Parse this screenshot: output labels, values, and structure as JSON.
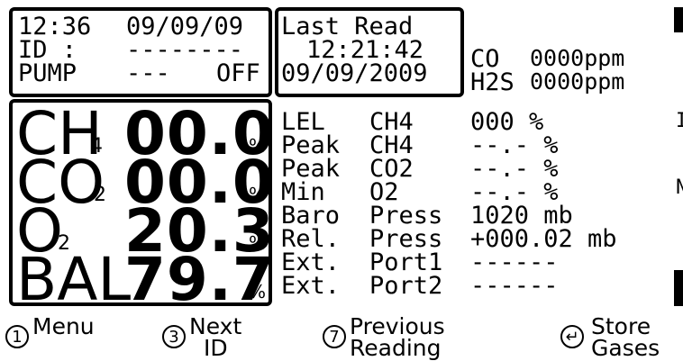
{
  "header_left": {
    "time": "12:36",
    "date": "09/09/09",
    "id_label": "ID :",
    "id_value": "--------",
    "pump_label": "PUMP",
    "pump_dashes": "---",
    "pump_state": "OFF"
  },
  "header_mid": {
    "title": "Last Read",
    "time": "12:21:42",
    "date": "09/09/2009"
  },
  "header_right": {
    "co_label": "CO",
    "co_value": "0000ppm",
    "h2s_label": "H2S",
    "h2s_value": "0000ppm"
  },
  "gases": [
    {
      "name": "CH",
      "sub": "4",
      "value": "00.0",
      "unit": "%"
    },
    {
      "name": "CO",
      "sub": "2",
      "value": "00.0",
      "unit": "%"
    },
    {
      "name": "O",
      "sub": "2",
      "value": "20.3",
      "unit": "%"
    },
    {
      "name": "BAL",
      "sub": "",
      "value": "79.7",
      "unit": "%"
    }
  ],
  "details": [
    {
      "a": "LEL",
      "b": "CH4",
      "v": "000 %"
    },
    {
      "a": "Peak",
      "b": "CH4",
      "v": "--.- %"
    },
    {
      "a": "Peak",
      "b": "CO2",
      "v": "--.- %"
    },
    {
      "a": "Min",
      "b": "O2",
      "v": "--.- %"
    },
    {
      "a": "Baro",
      "b": "Press",
      "v": "1020 mb"
    },
    {
      "a": "Rel.",
      "b": "Press",
      "v": "+000.02 mb"
    },
    {
      "a": "Ext.",
      "b": "Port1",
      "v": "------"
    },
    {
      "a": "Ext.",
      "b": "Port2",
      "v": "------"
    }
  ],
  "nav": [
    {
      "key": "1",
      "line1": "Menu",
      "line2": ""
    },
    {
      "key": "3",
      "line1": "Next",
      "line2": "ID"
    },
    {
      "key": "7",
      "line1": "Previous",
      "line2": "Reading"
    },
    {
      "key": "↵",
      "line1": "Store",
      "line2": "Gases"
    }
  ],
  "right_edge": [
    "I",
    "N"
  ]
}
